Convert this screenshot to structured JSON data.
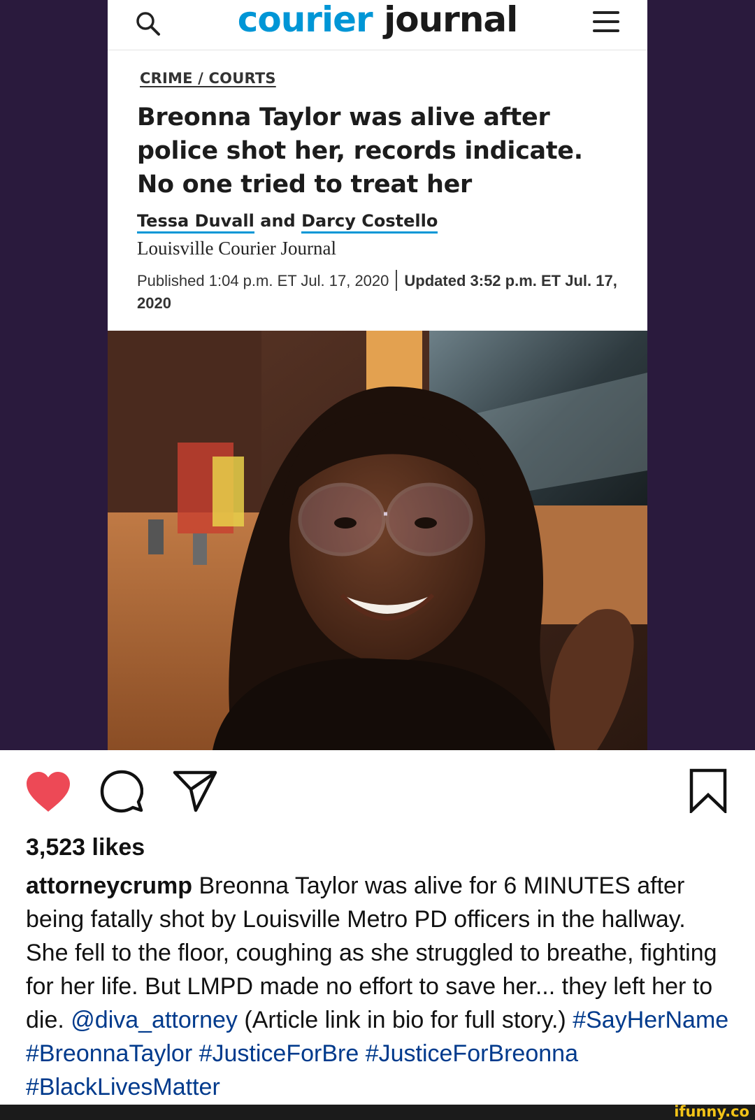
{
  "article": {
    "masthead": {
      "logo_part1": "courier",
      "logo_part2": "journal",
      "search_icon": "search-icon",
      "menu_icon": "hamburger-menu-icon"
    },
    "section": "CRIME / COURTS",
    "headline_lines": [
      "Breonna Taylor was alive after",
      "police shot her, records indicate.",
      "No one tried to treat her"
    ],
    "author1": "Tessa Duvall",
    "author_joiner": " and ",
    "author2": "Darcy Costello",
    "outlet": "Louisville Courier Journal",
    "published": "Published 1:04 p.m. ET Jul. 17, 2020",
    "updated": "Updated 3:52 p.m. ET Jul. 17, 2020"
  },
  "post": {
    "icons": {
      "like": "heart-icon",
      "comment": "comment-icon",
      "share": "send-icon",
      "save": "bookmark-icon"
    },
    "like_color": "#ed4956",
    "likes": "3,523 likes",
    "username": "attorneycrump",
    "caption_text": " Breonna Taylor was alive for 6 MINUTES after being fatally shot by Louisville Metro PD officers in the hallway. She fell to the floor, coughing as she struggled to breathe, fighting for her life. But LMPD made no effort to save her... they left her to die. ",
    "mention": "@diva_attorney",
    "caption_tail": " (Article link in bio for full story.) ",
    "hashtags": [
      "#SayHerName",
      "#BreonnaTaylor",
      "#JusticeForBre",
      "#JusticeForBreonna",
      "#BlackLivesMatter"
    ],
    "link_color": "#003a8c"
  },
  "watermark": "ifunny.co",
  "colors": {
    "frame_bg": "#2a1a3d",
    "brand_blue": "#0096d6"
  }
}
